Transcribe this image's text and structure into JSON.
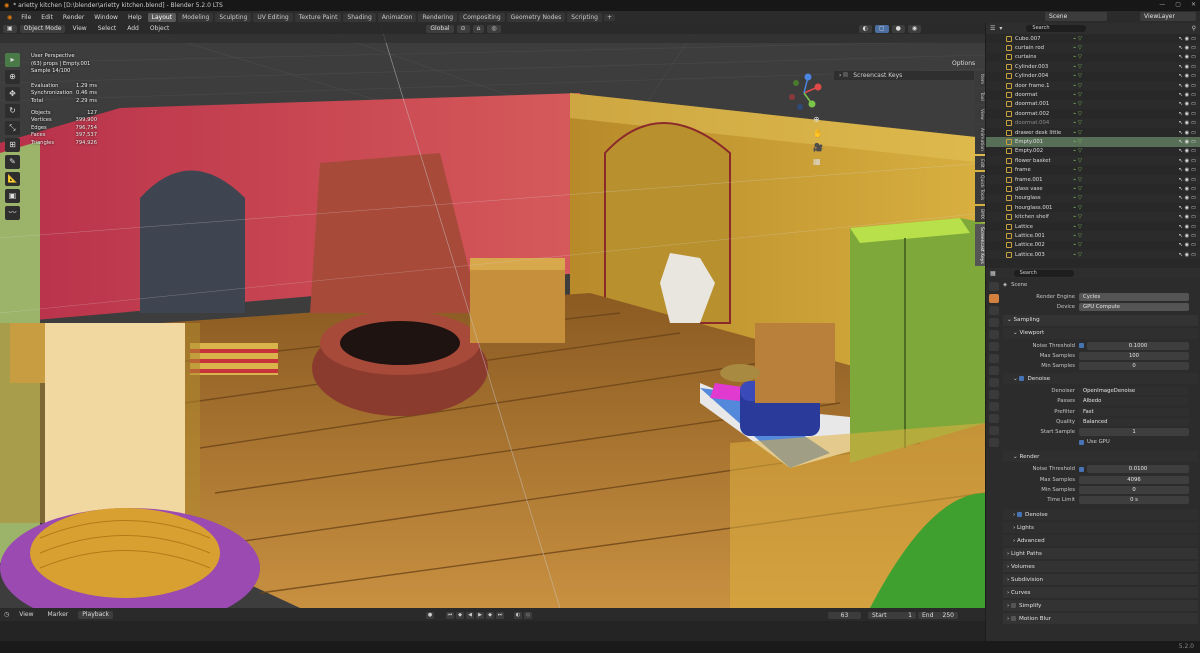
{
  "window": {
    "title": "* arietty kitchen [D:\\blender\\arietty kitchen.blend] - Blender 5.2.0 LTS",
    "controls": [
      "—",
      "▢",
      "✕"
    ]
  },
  "menus": [
    "File",
    "Edit",
    "Render",
    "Window",
    "Help"
  ],
  "workspaces": [
    "Layout",
    "Modeling",
    "Sculpting",
    "UV Editing",
    "Texture Paint",
    "Shading",
    "Animation",
    "Rendering",
    "Compositing",
    "Geometry Nodes",
    "Scripting"
  ],
  "active_workspace": "Layout",
  "scene_name": "Scene",
  "view_layer": "ViewLayer",
  "viewport": {
    "mode": "Object Mode",
    "header_menus": [
      "View",
      "Select",
      "Add",
      "Object"
    ],
    "orientation": "Global",
    "options": "Options",
    "perspective": "User Perspective",
    "collection_path": "(63) props | Empty.001",
    "sample": "Sample 14/100",
    "timings": [
      {
        "label": "Evaluation",
        "value": "1.29 ms"
      },
      {
        "label": "Synchronization",
        "value": "0.46 ms"
      },
      {
        "label": "Total",
        "value": "2.29 ms"
      }
    ],
    "stats": [
      {
        "label": "Objects",
        "value": "127"
      },
      {
        "label": "Vertices",
        "value": "399,900"
      },
      {
        "label": "Edges",
        "value": "796,754"
      },
      {
        "label": "Faces",
        "value": "397,537"
      },
      {
        "label": "Triangles",
        "value": "794,926"
      }
    ],
    "screencast": "Screencast Keys",
    "npanel_tabs": [
      "Item",
      "Tool",
      "View",
      "Animation",
      "Edit",
      "Quick Tools",
      "BMX",
      "Screencast Keys"
    ]
  },
  "timeline": {
    "menus": [
      "View",
      "Marker"
    ],
    "playback": "Playback",
    "current_frame": "63",
    "start_label": "Start",
    "start": "1",
    "end_label": "End",
    "end": "250"
  },
  "outliner": {
    "search_placeholder": "Search",
    "rows": [
      {
        "name": "Cube.007",
        "dim": false
      },
      {
        "name": "curtain rod",
        "dim": false
      },
      {
        "name": "curtains",
        "dim": false
      },
      {
        "name": "Cylinder.003",
        "dim": false
      },
      {
        "name": "Cylinder.004",
        "dim": false
      },
      {
        "name": "door frame.1",
        "dim": false
      },
      {
        "name": "doormat",
        "dim": false
      },
      {
        "name": "doormat.001",
        "dim": false
      },
      {
        "name": "doormat.002",
        "dim": false
      },
      {
        "name": "doormat.004",
        "dim": true
      },
      {
        "name": "drawer desk little",
        "dim": false
      },
      {
        "name": "Empty.001",
        "dim": false,
        "sel": true
      },
      {
        "name": "Empty.002",
        "dim": false
      },
      {
        "name": "flower basket",
        "dim": false
      },
      {
        "name": "frame",
        "dim": false
      },
      {
        "name": "frame.001",
        "dim": false
      },
      {
        "name": "glass vase",
        "dim": false
      },
      {
        "name": "hourglass",
        "dim": false
      },
      {
        "name": "hourglass.001",
        "dim": false
      },
      {
        "name": "kitchen shelf",
        "dim": false
      },
      {
        "name": "Lattice",
        "dim": false
      },
      {
        "name": "Lattice.001",
        "dim": false
      },
      {
        "name": "Lattice.002",
        "dim": false
      },
      {
        "name": "Lattice.003",
        "dim": false
      }
    ]
  },
  "properties": {
    "search_placeholder": "Search",
    "scene": "Scene",
    "render_engine_label": "Render Engine",
    "render_engine": "Cycles",
    "device_label": "Device",
    "device": "GPU Compute",
    "sampling": "Sampling",
    "viewport": "Viewport",
    "noise_threshold_label": "Noise Threshold",
    "vp_noise_threshold": "0.1000",
    "max_samples_label": "Max Samples",
    "vp_max_samples": "100",
    "min_samples_label": "Min Samples",
    "vp_min_samples": "0",
    "denoise": "Denoise",
    "denoiser_label": "Denoiser",
    "denoiser": "OpenImageDenoise",
    "passes_label": "Passes",
    "passes": "Albedo",
    "prefilter_label": "Prefilter",
    "prefilter": "Fast",
    "quality_label": "Quality",
    "quality": "Balanced",
    "start_sample_label": "Start Sample",
    "start_sample": "1",
    "use_gpu": "Use GPU",
    "render": "Render",
    "r_noise_threshold": "0.0100",
    "r_max_samples": "4096",
    "r_min_samples": "0",
    "time_limit_label": "Time Limit",
    "time_limit": "0 s",
    "render_denoise": "Denoise",
    "lights": "Lights",
    "advanced": "Advanced",
    "light_paths": "Light Paths",
    "volumes": "Volumes",
    "subdivision": "Subdivision",
    "curves": "Curves",
    "simplify": "Simplify",
    "motion_blur": "Motion Blur"
  },
  "version": "5.2.0",
  "colors": {
    "accent": "#4772b3",
    "selection": "#586f57",
    "active_tab": "#d3803f"
  }
}
